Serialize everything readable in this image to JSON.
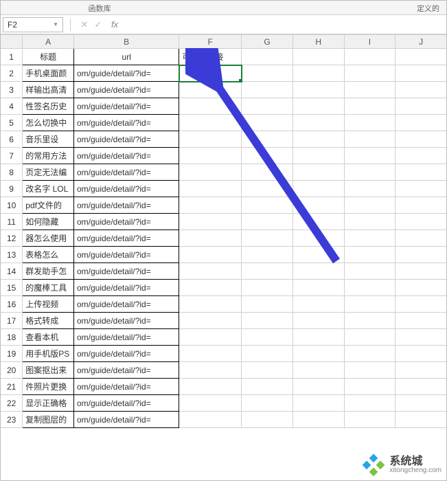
{
  "ribbon": {
    "library": "函数库",
    "defined": "定义的"
  },
  "namebox": {
    "value": "F2"
  },
  "fx": {
    "cancel": "✕",
    "confirm": "✓",
    "fx": "fx"
  },
  "columns": [
    "A",
    "B",
    "F",
    "G",
    "H",
    "I",
    "J"
  ],
  "header_row": {
    "A": "标题",
    "B": "url",
    "F": "可点击链接"
  },
  "rows": [
    {
      "n": "1"
    },
    {
      "n": "2",
      "A": "手机桌面颜",
      "B": "om/guide/detail/?id="
    },
    {
      "n": "3",
      "A": "样输出高清",
      "B": "om/guide/detail/?id="
    },
    {
      "n": "4",
      "A": "性签名历史",
      "B": "om/guide/detail/?id="
    },
    {
      "n": "5",
      "A": "怎么切换中",
      "B": "om/guide/detail/?id="
    },
    {
      "n": "6",
      "A": "音乐里设",
      "B": "om/guide/detail/?id="
    },
    {
      "n": "7",
      "A": "的常用方法",
      "B": "om/guide/detail/?id="
    },
    {
      "n": "8",
      "A": "页定无法编",
      "B": "om/guide/detail/?id="
    },
    {
      "n": "9",
      "A": "改名字 LOL",
      "B": "om/guide/detail/?id="
    },
    {
      "n": "10",
      "A": "pdf文件的",
      "B": "om/guide/detail/?id="
    },
    {
      "n": "11",
      "A": "如何隐藏",
      "B": "om/guide/detail/?id="
    },
    {
      "n": "12",
      "A": "器怎么使用",
      "B": "om/guide/detail/?id="
    },
    {
      "n": "13",
      "A": "表格怎么",
      "B": "om/guide/detail/?id="
    },
    {
      "n": "14",
      "A": "群发助手怎",
      "B": "om/guide/detail/?id="
    },
    {
      "n": "15",
      "A": "的魔棒工具",
      "B": "om/guide/detail/?id="
    },
    {
      "n": "16",
      "A": "上传视频",
      "B": "om/guide/detail/?id="
    },
    {
      "n": "17",
      "A": "格式转成",
      "B": "om/guide/detail/?id="
    },
    {
      "n": "18",
      "A": "查看本机",
      "B": "om/guide/detail/?id="
    },
    {
      "n": "19",
      "A": "用手机版PS",
      "B": "om/guide/detail/?id="
    },
    {
      "n": "20",
      "A": "图案抠出来",
      "B": "om/guide/detail/?id="
    },
    {
      "n": "21",
      "A": "件照片更换",
      "B": "om/guide/detail/?id="
    },
    {
      "n": "22",
      "A": "显示正确格",
      "B": "om/guide/detail/?id="
    },
    {
      "n": "23",
      "A": "复制图层的",
      "B": "om/guide/detail/?id="
    }
  ],
  "watermark": {
    "title": "系统城",
    "sub": "xitongcheng.com"
  }
}
